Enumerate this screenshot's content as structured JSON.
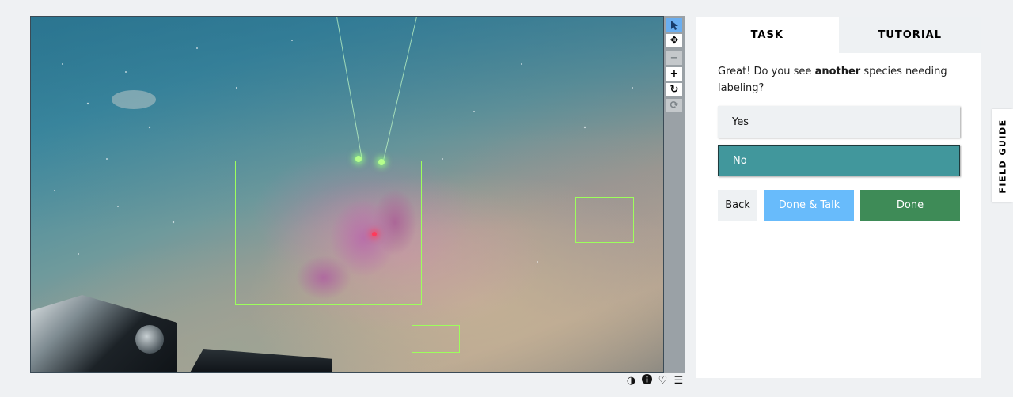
{
  "subject": {
    "toolbar": {
      "pointer_icon": "cursor-arrow-icon",
      "move_icon": "move-arrows-icon",
      "zoom_out_icon": "minus-icon",
      "zoom_in_icon": "plus-icon",
      "rotate_icon": "rotate-icon",
      "reset_icon": "reset-icon"
    },
    "meta": {
      "invert_icon": "invert-contrast-icon",
      "info_icon": "info-icon",
      "favorite_icon": "heart-icon",
      "collections_icon": "list-icon"
    }
  },
  "task_panel": {
    "tabs": [
      {
        "label": "TASK",
        "active": true
      },
      {
        "label": "TUTORIAL",
        "active": false
      }
    ],
    "question": {
      "before": "Great! Do you see ",
      "emphasis": "another",
      "after": " species needing labeling?"
    },
    "answers": [
      {
        "label": "Yes",
        "selected": false
      },
      {
        "label": "No",
        "selected": true
      }
    ],
    "buttons": {
      "back": "Back",
      "done_talk": "Done & Talk",
      "done": "Done"
    }
  },
  "field_guide": {
    "label": "FIELD GUIDE"
  },
  "colors": {
    "selected_answer": "#41979c",
    "done_talk": "#68bbfb",
    "done": "#3e8b57",
    "annotation_box": "#9dff5c"
  }
}
